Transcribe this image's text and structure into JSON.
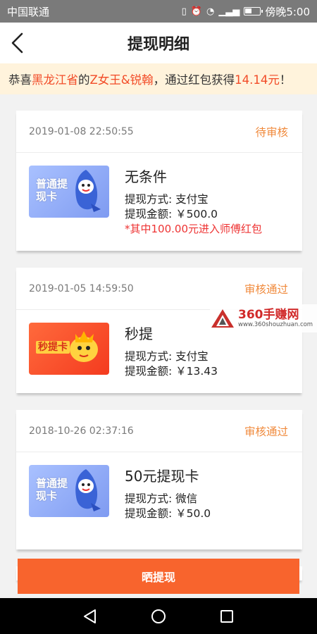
{
  "statusbar": {
    "carrier": "中国联通",
    "time": "傍晚5:00"
  },
  "navbar": {
    "title": "提现明细"
  },
  "notice": {
    "prefix": "恭喜",
    "province": "黑龙江省",
    "mid1": "的",
    "user": "Z女王&锐翰",
    "mid2": "，通过红包获得",
    "amount": "14.14元",
    "suffix": "！"
  },
  "records": [
    {
      "time": "2019-01-08 22:50:55",
      "status": "待审核",
      "card_label": "普通提现卡",
      "name": "无条件",
      "method": "提现方式: 支付宝",
      "amount": "提现金额: ￥500.0",
      "note": "*其中100.00元进入师傅红包"
    },
    {
      "time": "2019-01-05 14:59:50",
      "status": "审核通过",
      "card_label": "秒提卡",
      "name": "秒提",
      "method": "提现方式: 支付宝",
      "amount": "提现金额: ￥13.43"
    },
    {
      "time": "2018-10-26 02:37:16",
      "status": "审核通过",
      "card_label": "普通提现卡",
      "name": "50元提现卡",
      "method": "提现方式: 微信",
      "amount": "提现金额: ￥50.0"
    }
  ],
  "watermark": {
    "name": "360手赚网",
    "url": "www.360shouzhuan.com"
  },
  "bottom_button": {
    "label": "晒提现"
  },
  "colors": {
    "accent": "#f8642d",
    "status": "#f08a3c",
    "highlight": "#f24b27"
  }
}
